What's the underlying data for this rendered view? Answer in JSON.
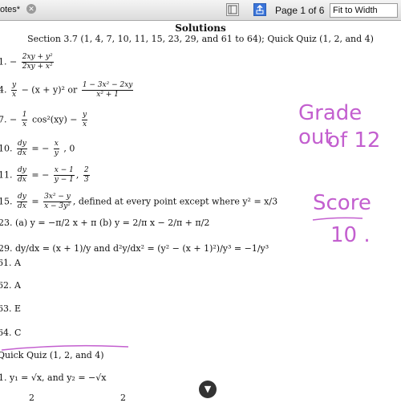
{
  "toolbar": {
    "doc_tab": "otes*",
    "page_indicator": "Page 1 of 6",
    "zoom": "Fit to Width",
    "close_icon": "close-icon",
    "sidebar_icon": "sidebar-icon",
    "export_icon": "share-icon",
    "accent": "#3a74d9"
  },
  "doc": {
    "title": "Solutions",
    "subtitle": "Section 3.7 (1, 4, 7, 10, 11, 15, 23, 29, and 61 to 64); Quick Quiz (1, 2, and 4)",
    "p1": {
      "label": "1.",
      "num": "2xy + y²",
      "den": "2xy + x²"
    },
    "p4": {
      "label": "4.",
      "a_num": "y",
      "a_den": "x",
      "mid": "− (x + y)² or",
      "b_num": "1 − 3x² − 2xy",
      "b_den": "x² + 1"
    },
    "p7": {
      "label": "7.",
      "a_num": "1",
      "a_den": "x",
      "mid": "cos²(xy) −",
      "b_num": "y",
      "b_den": "x",
      "lead": "−"
    },
    "p10": {
      "label": "10.",
      "a_num": "dy",
      "a_den": "dx",
      "eq": "= −",
      "b_num": "x",
      "b_den": "y",
      "tail": ", 0"
    },
    "p11": {
      "label": "11.",
      "a_num": "dy",
      "a_den": "dx",
      "eq": "= −",
      "b_num": "x − 1",
      "b_den": "y − 1",
      "c_num": "2",
      "c_den": "3"
    },
    "p15": {
      "label": "15.",
      "a_num": "dy",
      "a_den": "dx",
      "b_num": "3x² − y",
      "b_den": "x − 3y²",
      "tail": ", defined at every point except where y² = x/3"
    },
    "p23": {
      "label": "23.",
      "text": "(a) y = −π/2 x + π  (b) y = 2/π x − 2/π + π/2"
    },
    "p29": {
      "label": "29.",
      "text": "dy/dx = (x + 1)/y and d²y/dx² = (y² − (x + 1)²)/y³ = −1/y³"
    },
    "answers": [
      {
        "label": "61.",
        "value": "A"
      },
      {
        "label": "62.",
        "value": "A"
      },
      {
        "label": "63.",
        "value": "E"
      },
      {
        "label": "64.",
        "value": "C"
      }
    ],
    "quiz_heading": "Quick Quiz (1, 2, and 4)",
    "quiz1": {
      "label": "1.",
      "text": "y₁ = √x, and y₂ = −√x"
    },
    "quiz2": {
      "label": "2",
      "text": "2"
    }
  },
  "ink": {
    "color": "#c35fcf",
    "note1": "Grade out",
    "note2": "of 12",
    "note3": "Score",
    "note4": "10 ."
  }
}
